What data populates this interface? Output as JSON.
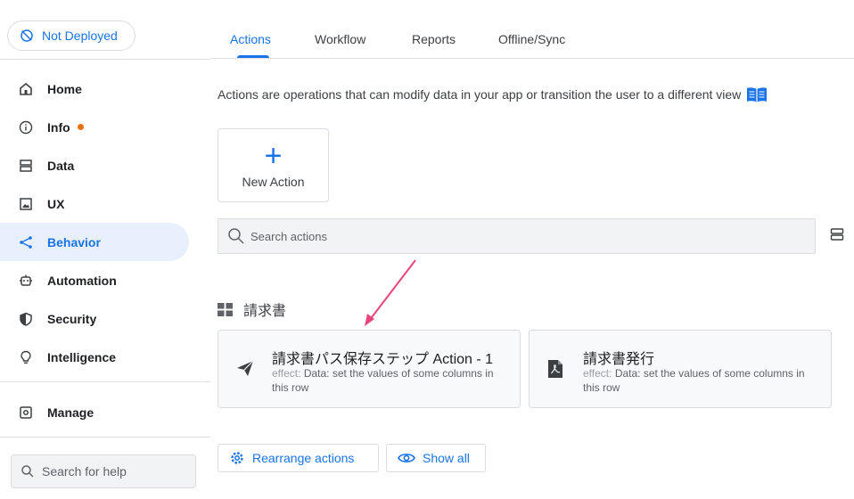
{
  "deploy": {
    "label": "Not Deployed"
  },
  "sidebar": {
    "items": [
      {
        "label": "Home",
        "icon": "home-icon"
      },
      {
        "label": "Info",
        "icon": "info-icon",
        "badge_color": "#e8710a"
      },
      {
        "label": "Data",
        "icon": "data-icon"
      },
      {
        "label": "UX",
        "icon": "image-icon"
      },
      {
        "label": "Behavior",
        "icon": "behavior-icon",
        "active": true
      },
      {
        "label": "Automation",
        "icon": "robot-icon"
      },
      {
        "label": "Security",
        "icon": "shield-icon"
      },
      {
        "label": "Intelligence",
        "icon": "lightbulb-icon"
      }
    ],
    "manage": {
      "label": "Manage",
      "icon": "gear-icon"
    },
    "help_search": {
      "placeholder": "Search for help"
    }
  },
  "tabs": [
    {
      "label": "Actions",
      "active": true
    },
    {
      "label": "Workflow"
    },
    {
      "label": "Reports"
    },
    {
      "label": "Offline/Sync"
    }
  ],
  "main": {
    "description": "Actions are operations that can modify data in your app or transition the user to a different view",
    "new_action_label": "New Action",
    "search_placeholder": "Search actions",
    "group_title": "請求書",
    "cards": [
      {
        "title": "請求書パス保存ステップ Action - 1",
        "effect_label": "effect:",
        "effect_text": "Data: set the values of some columns in this row",
        "icon": "send-icon"
      },
      {
        "title": "請求書発行",
        "effect_label": "effect:",
        "effect_text": "Data: set the values of some columns in this row",
        "icon": "pdf-icon"
      }
    ],
    "rearrange_label": "Rearrange actions",
    "show_all_label": "Show all"
  },
  "colors": {
    "accent": "#1a73e8",
    "active_bg": "#e8f0fe",
    "badge": "#e8710a",
    "arrow": "#e8457a"
  }
}
